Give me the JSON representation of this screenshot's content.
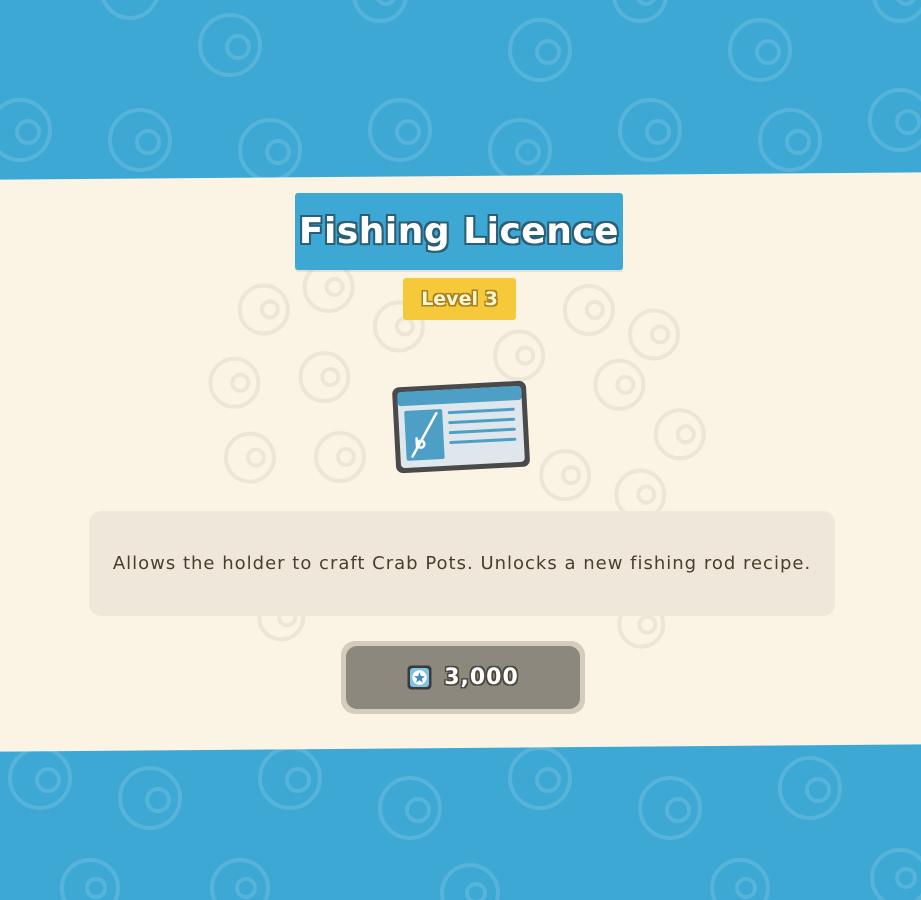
{
  "title": "Fishing Licence",
  "level_label": "Level 3",
  "description": "Allows the holder to craft Crab Pots. Unlocks a new fishing rod recipe.",
  "price": {
    "icon": "bells-coin-icon",
    "amount": "3,000"
  },
  "item_icon": "fishing-licence-card-icon",
  "colors": {
    "background_blue": "#3ea8d4",
    "panel_cream": "#fbf3e4",
    "title_bg": "#3ea8d4",
    "level_bg": "#f6c93b",
    "description_bg": "#efe8da",
    "price_button_bg": "#8d887d"
  }
}
